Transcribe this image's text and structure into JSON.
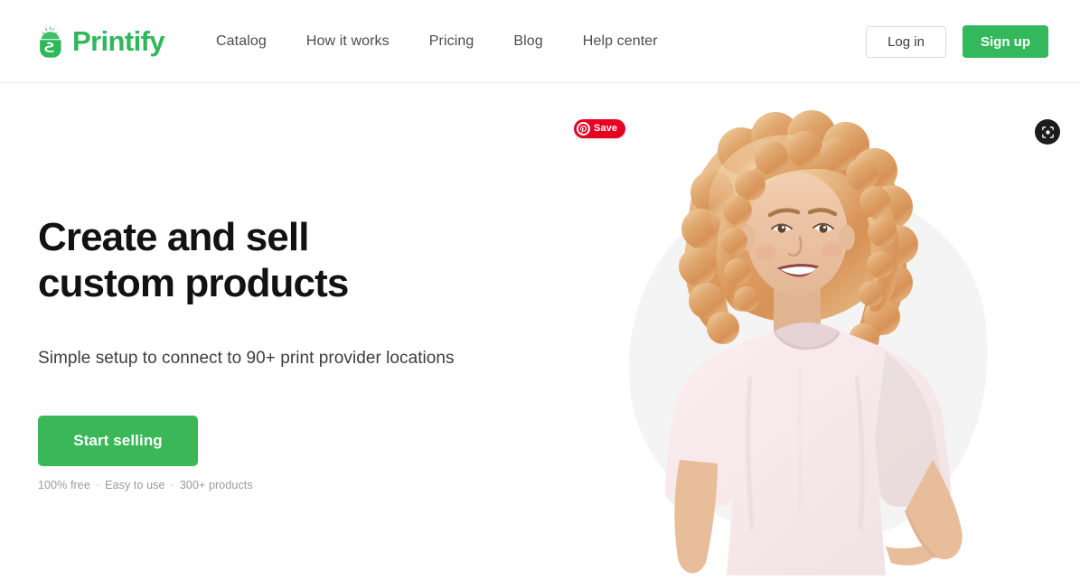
{
  "brand": {
    "name": "Printify",
    "logo_icon": "printify-logo-icon",
    "brand_color": "#2eb85c"
  },
  "header": {
    "nav": [
      {
        "label": "Catalog"
      },
      {
        "label": "How it works"
      },
      {
        "label": "Pricing"
      },
      {
        "label": "Blog"
      },
      {
        "label": "Help center"
      }
    ],
    "login_label": "Log in",
    "signup_label": "Sign up",
    "signup_color": "#34b85c"
  },
  "hero": {
    "title_line1": "Create and sell",
    "title_line2": "custom products",
    "subtitle": "Simple setup to connect to 90+ print provider locations",
    "cta_label": "Start selling",
    "cta_color": "#3ab757",
    "note_items": [
      "100% free",
      "Easy to use",
      "300+ products"
    ],
    "note_separator": "·",
    "image_alt": "Smiling woman with curly blonde hair wearing a light pink t-shirt",
    "blob_color": "#f4f4f4"
  },
  "overlays": {
    "pinterest_save_label": "Save",
    "pinterest_color": "#e60023",
    "pinterest_icon": "pinterest-icon",
    "capture_icon": "screenshot-capture-icon"
  }
}
